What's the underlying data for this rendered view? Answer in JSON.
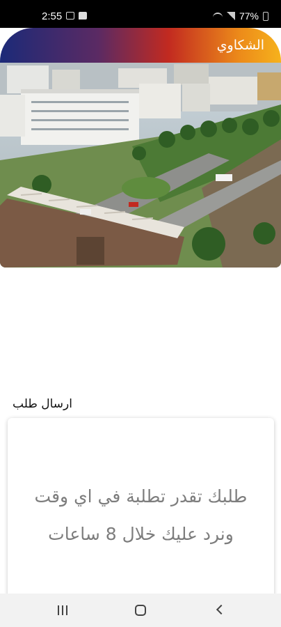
{
  "status_bar": {
    "time": "2:55",
    "battery": "77%"
  },
  "header": {
    "title": "الشكاوي",
    "gradient": [
      "#1c2a78",
      "#c22a20",
      "#f6b21c"
    ]
  },
  "carousel": {
    "dot_count": 11,
    "active_dot_index": 6,
    "dot_color": "#f5e51b",
    "active_dot_color": "#1b2eb0"
  },
  "request": {
    "section_title": "ارسال طلب",
    "card_line_1": "طلبك تقدر تطلبة في اي وقت",
    "card_line_2": "ونرد عليك خلال 8 ساعات"
  },
  "nav": {
    "icons": [
      "recent-apps-icon",
      "home-icon",
      "back-icon"
    ]
  }
}
